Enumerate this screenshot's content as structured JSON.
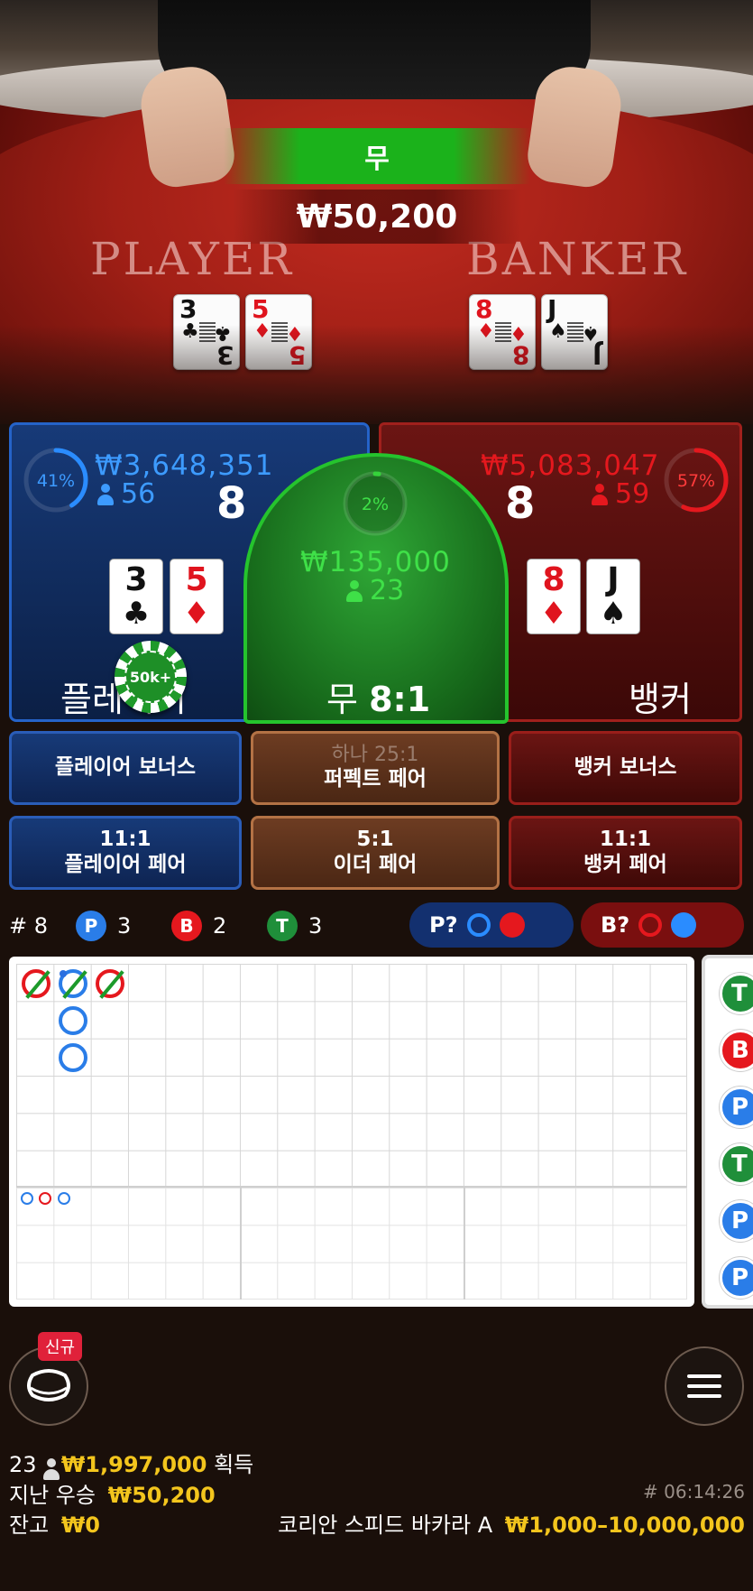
{
  "video": {
    "result": "무",
    "win_amount": "₩50,200",
    "player_label": "PLAYER",
    "banker_label": "BANKER",
    "player_cards": [
      {
        "rank": "3",
        "suit": "♣",
        "color": "blk"
      },
      {
        "rank": "5",
        "suit": "♦",
        "color": "red"
      }
    ],
    "banker_cards": [
      {
        "rank": "8",
        "suit": "♦",
        "color": "red"
      },
      {
        "rank": "J",
        "suit": "♠",
        "color": "blk"
      }
    ]
  },
  "player": {
    "percent": "41%",
    "percent_value": 0.41,
    "total": "₩3,648,351",
    "bettors": "56",
    "score": "8",
    "label": "플레이어",
    "cards": [
      {
        "rank": "3",
        "suit": "♣",
        "color": "blk"
      },
      {
        "rank": "5",
        "suit": "♦",
        "color": "red"
      }
    ],
    "chip_label": "50k+"
  },
  "tie": {
    "percent": "2%",
    "percent_value": 0.02,
    "total": "₩135,000",
    "bettors": "23",
    "label": "무",
    "payout": "8:1"
  },
  "banker": {
    "percent": "57%",
    "percent_value": 0.57,
    "total": "₩5,083,047",
    "bettors": "59",
    "score": "8",
    "label": "뱅커",
    "cards": [
      {
        "rank": "8",
        "suit": "♦",
        "color": "red"
      },
      {
        "rank": "J",
        "suit": "♠",
        "color": "blk"
      }
    ]
  },
  "side_bets": {
    "player_bonus": "플레이어 보너스",
    "perfect_pair_top": "하나 25:1",
    "perfect_pair": "퍼펙트 페어",
    "banker_bonus": "뱅커 보너스",
    "player_pair_odds": "11:1",
    "player_pair": "플레이어 페어",
    "either_pair_odds": "5:1",
    "either_pair": "이더 페어",
    "banker_pair_odds": "11:1",
    "banker_pair": "뱅커 페어"
  },
  "stats": {
    "round_label": "# 8",
    "p_letter": "P",
    "p_count": "3",
    "b_letter": "B",
    "b_count": "2",
    "t_letter": "T",
    "t_count": "3",
    "player_predict": "P?",
    "banker_predict": "B?"
  },
  "road_side": [
    "T",
    "B",
    "P",
    "T",
    "P",
    "P"
  ],
  "footer": {
    "new_badge": "신규",
    "players": "23",
    "won_amount": "₩1,997,000",
    "won_label": "획득",
    "last_win_label": "지난 우승",
    "last_win": "₩50,200",
    "balance_label": "잔고",
    "balance": "₩0",
    "time": "# 06:14:26",
    "table_name": "코리안 스피드 바카라 A",
    "limits": "₩1,000–10,000,000"
  },
  "colors": {
    "player_blue": "#2a8cff",
    "banker_red": "#e5181e",
    "tie_green": "#35d43a",
    "gold": "#f3c51d"
  }
}
